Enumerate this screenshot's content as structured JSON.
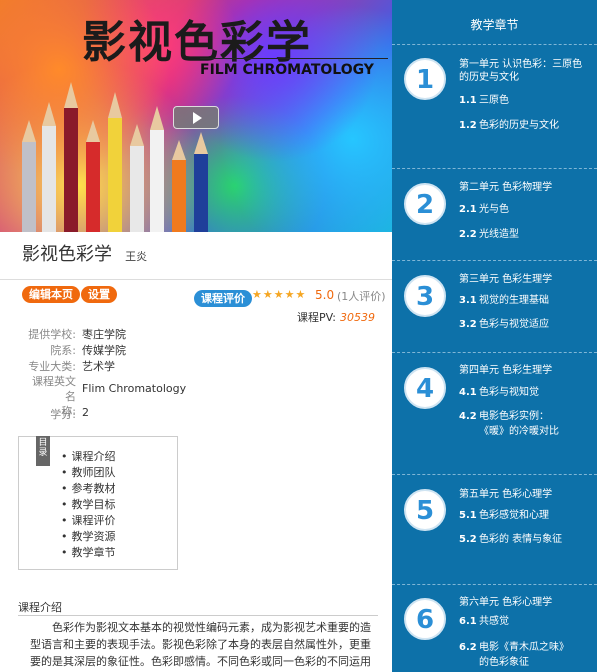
{
  "banner": {
    "title": "影视色彩学",
    "subtitle": "FILM CHROMATOLOGY"
  },
  "course": {
    "name": "影视色彩学",
    "teacher": "王炎"
  },
  "actions": {
    "edit_label": "编辑本页",
    "settings_label": "设置",
    "evaluate_label": "课程评价"
  },
  "rating": {
    "stars": "★★★★★",
    "score": "5.0",
    "count_text": "(1人评价)"
  },
  "pv": {
    "label": "课程PV:",
    "value": "30539"
  },
  "info": [
    {
      "key": "提供学校:",
      "value": "枣庄学院"
    },
    {
      "key": "院系:",
      "value": "传媒学院"
    },
    {
      "key": "专业大类:",
      "value": "艺术学"
    },
    {
      "key_line1": "课程英文名",
      "key_line2": "称:",
      "value": "Flim Chromatology"
    },
    {
      "key": "学分:",
      "value": "2"
    }
  ],
  "toc": {
    "tag": "目录",
    "items": [
      "课程介绍",
      "教师团队",
      "参考教材",
      "教学目标",
      "课程评价",
      "教学资源",
      "教学章节"
    ]
  },
  "intro": {
    "heading": "课程介绍",
    "text": "色彩作为影视文本基本的视觉性编码元素，成为影视艺术重要的造型语言和主要的表现手法。影视色彩除了本身的表层自然属性外，更重要的是其深层的象征性。色彩即感情。不同色彩或同一色彩的不同运用能引起不同的情感反应，产生相应的情绪效果，影视色彩也被称作影像"
  },
  "chapters": {
    "heading": "教学章节",
    "units": [
      {
        "num": "1",
        "title": "第一单元 认识色彩：三原色的历史与文化",
        "sections": [
          {
            "n": "1.1",
            "t": "三原色"
          },
          {
            "n": "1.2",
            "t": "色彩的历史与文化"
          }
        ]
      },
      {
        "num": "2",
        "title": "第二单元 色彩物理学",
        "sections": [
          {
            "n": "2.1",
            "t": "光与色"
          },
          {
            "n": "2.2",
            "t": "光线造型"
          }
        ]
      },
      {
        "num": "3",
        "title": "第三单元 色彩生理学",
        "sections": [
          {
            "n": "3.1",
            "t": "视觉的生理基础"
          },
          {
            "n": "3.2",
            "t": "色彩与视觉适应"
          }
        ]
      },
      {
        "num": "4",
        "title": "第四单元 色彩生理学",
        "sections": [
          {
            "n": "4.1",
            "t": "色彩与视知觉"
          },
          {
            "n": "4.2",
            "t": "电影色彩实例：《暖》的冷暖对比"
          }
        ]
      },
      {
        "num": "5",
        "title": "第五单元 色彩心理学",
        "sections": [
          {
            "n": "5.1",
            "t": "色彩感觉和心理"
          },
          {
            "n": "5.2",
            "t": "色彩的 表情与象征"
          }
        ]
      },
      {
        "num": "6",
        "title": "第六单元 色彩心理学",
        "sections": [
          {
            "n": "6.1",
            "t": "共感觉"
          },
          {
            "n": "6.2",
            "t": "电影《青木瓜之味》的色彩象征"
          }
        ]
      }
    ]
  },
  "colors": {
    "accent_orange": "#f0690e",
    "accent_blue": "#2b8fd6",
    "sidebar_blue": "#0d71a9"
  }
}
